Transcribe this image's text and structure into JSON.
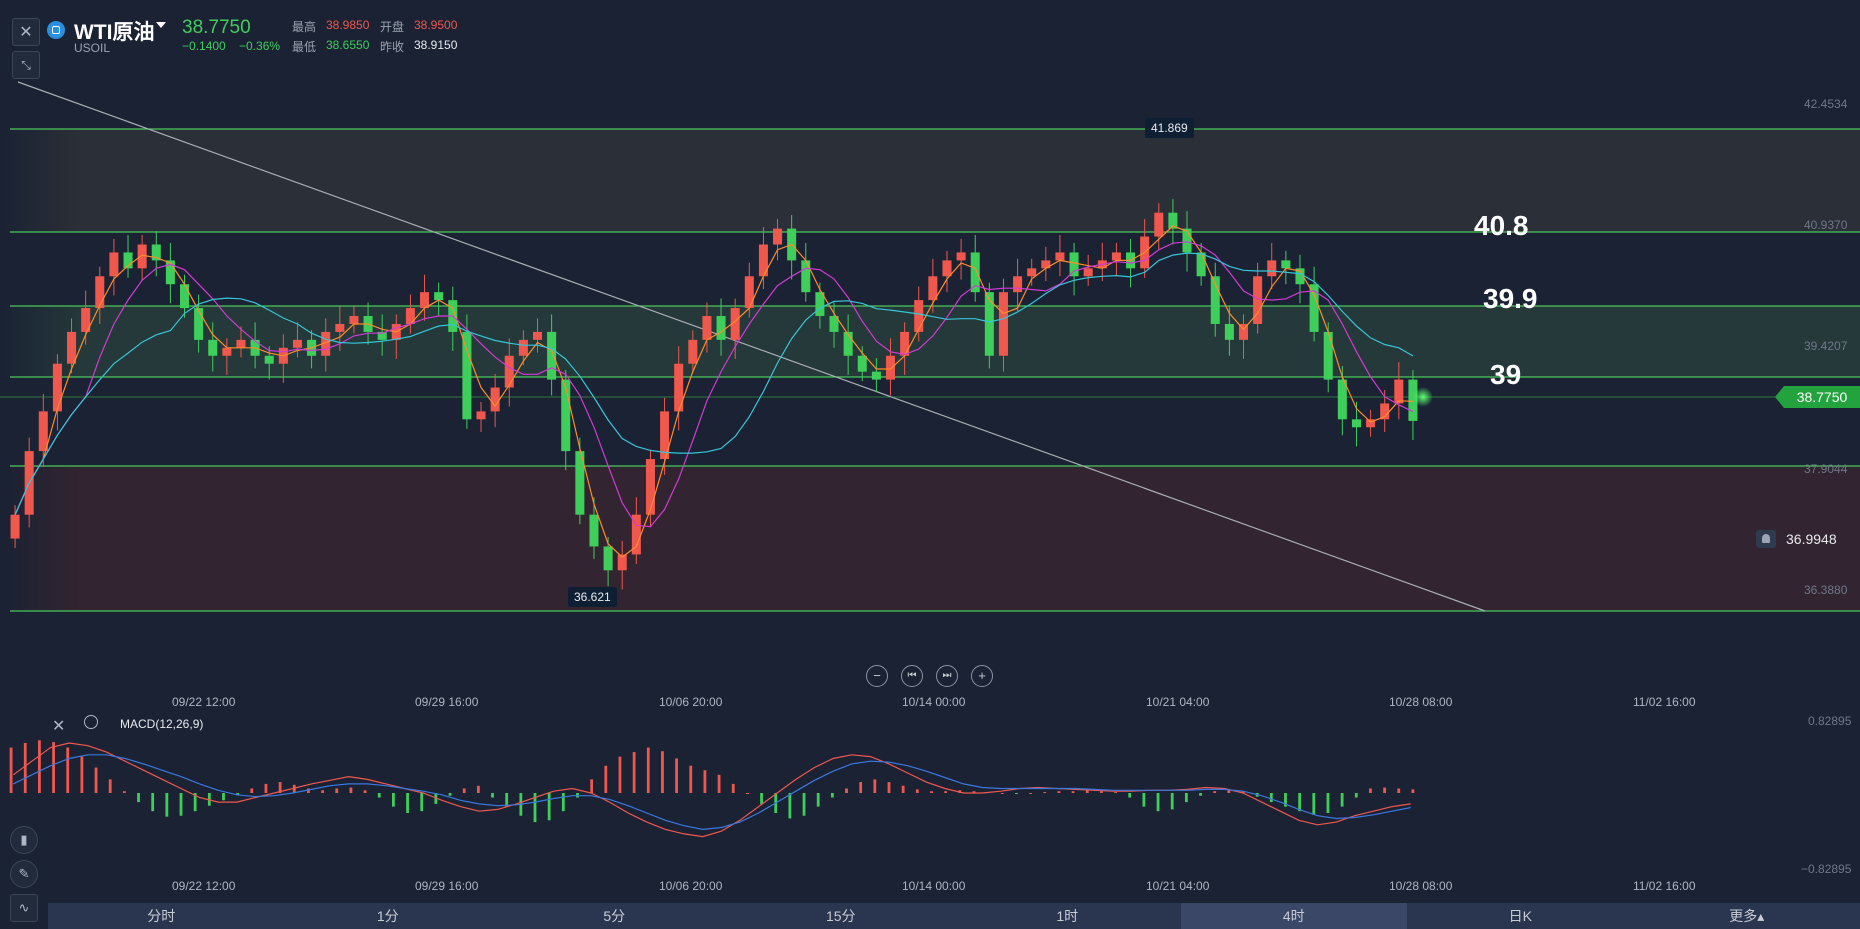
{
  "header": {
    "title": "WTI原油",
    "symbol": "USOIL",
    "price": "38.7750",
    "change": "−0.1400",
    "change_pct": "−0.36%",
    "stats": {
      "high_label": "最高",
      "high": "38.9850",
      "open_label": "开盘",
      "open": "38.9500",
      "low_label": "最低",
      "low": "38.6550",
      "prev_label": "昨收",
      "prev": "38.9150"
    }
  },
  "main_chart": {
    "y_axis_labels": [
      "42.4534",
      "40.9370",
      "39.4207",
      "37.9044",
      "36.3880"
    ],
    "x_axis_labels": [
      "09/22 12:00",
      "09/29 16:00",
      "10/06 20:00",
      "10/14 00:00",
      "10/21 04:00",
      "10/28 08:00",
      "11/02 16:00"
    ],
    "level_labels": [
      "40.8",
      "39.9",
      "39"
    ],
    "current_price_tag": "38.7750",
    "alert_price": "36.9948",
    "peak_label": "41.869",
    "trough_label": "36.621"
  },
  "indicator": {
    "label": "MACD(12,26,9)",
    "y_axis_labels": [
      "0.82895",
      "−0.82895"
    ],
    "x_axis_labels": [
      "09/22 12:00",
      "09/29 16:00",
      "10/06 20:00",
      "10/14 00:00",
      "10/21 04:00",
      "10/28 08:00",
      "11/02 16:00"
    ]
  },
  "timeframes": [
    {
      "label": "分时"
    },
    {
      "label": "1分"
    },
    {
      "label": "5分"
    },
    {
      "label": "15分"
    },
    {
      "label": "1时"
    },
    {
      "label": "4时"
    },
    {
      "label": "日K"
    },
    {
      "label": "更多▴"
    }
  ],
  "colors": {
    "up": "#f0584d",
    "down": "#3ecf5a",
    "accent": "#22a33e"
  },
  "chart_data": [
    {
      "type": "candlestick",
      "title": "",
      "ylim": [
        36.0,
        42.8
      ],
      "series": [
        {
          "name": "price",
          "close": [
            37.6,
            38.4,
            38.9,
            39.5,
            39.9,
            40.2,
            40.6,
            40.9,
            40.7,
            41.0,
            40.8,
            40.5,
            40.2,
            39.8,
            39.6,
            39.7,
            39.8,
            39.6,
            39.5,
            39.7,
            39.8,
            39.6,
            39.9,
            40.0,
            40.1,
            39.9,
            39.8,
            40.0,
            40.2,
            40.4,
            40.3,
            39.9,
            38.8,
            38.9,
            39.2,
            39.6,
            39.8,
            39.9,
            39.3,
            38.4,
            37.6,
            37.2,
            36.9,
            37.1,
            37.6,
            38.3,
            38.9,
            39.5,
            39.8,
            40.1,
            39.8,
            40.2,
            40.6,
            41.0,
            41.2,
            40.8,
            40.4,
            40.1,
            39.9,
            39.6,
            39.4,
            39.3,
            39.6,
            39.9,
            40.3,
            40.6,
            40.8,
            40.9,
            40.4,
            39.6,
            40.4,
            40.6,
            40.7,
            40.8,
            40.9,
            40.6,
            40.7,
            40.8,
            40.9,
            40.7,
            41.1,
            41.4,
            41.2,
            40.9,
            40.6,
            40.0,
            39.8,
            40.0,
            40.6,
            40.8,
            40.7,
            40.5,
            39.9,
            39.3,
            38.8,
            38.7,
            38.8,
            39.0,
            39.3,
            38.78
          ]
        },
        {
          "name": "MA5",
          "values": []
        },
        {
          "name": "MA10",
          "values": []
        },
        {
          "name": "MA20",
          "values": []
        }
      ],
      "horizontal_levels": [
        42.4534,
        40.937,
        39.9,
        39.0,
        37.9044,
        36.388
      ],
      "trendline": "descending"
    },
    {
      "type": "bar",
      "title": "MACD(12,26,9)",
      "ylim": [
        -0.82895,
        0.82895
      ],
      "series": [
        {
          "name": "histogram",
          "values": [
            0.5,
            0.55,
            0.58,
            0.56,
            0.5,
            0.4,
            0.28,
            0.15,
            0.02,
            -0.1,
            -0.2,
            -0.26,
            -0.25,
            -0.2,
            -0.14,
            -0.08,
            -0.02,
            0.05,
            0.1,
            0.12,
            0.09,
            0.05,
            0.03,
            0.05,
            0.06,
            0.03,
            -0.05,
            -0.15,
            -0.22,
            -0.2,
            -0.12,
            -0.03,
            0.05,
            0.08,
            -0.05,
            -0.15,
            -0.25,
            -0.32,
            -0.3,
            -0.2,
            -0.05,
            0.15,
            0.3,
            0.4,
            0.45,
            0.5,
            0.46,
            0.38,
            0.3,
            0.25,
            0.2,
            0.1,
            0.0,
            -0.12,
            -0.22,
            -0.28,
            -0.25,
            -0.15,
            -0.05,
            0.05,
            0.12,
            0.15,
            0.12,
            0.08,
            0.04,
            0.02,
            0.02,
            0.03,
            0.02,
            0.01,
            0.0,
            -0.01,
            0.0,
            0.01,
            0.02,
            0.02,
            0.03,
            0.02,
            0.01,
            -0.05,
            -0.15,
            -0.2,
            -0.18,
            -0.1,
            -0.03,
            0.02,
            0.04,
            0.02,
            -0.04,
            -0.1,
            -0.15,
            -0.2,
            -0.24,
            -0.22,
            -0.15,
            -0.05,
            0.05,
            0.06,
            0.05,
            0.04
          ]
        },
        {
          "name": "DIF",
          "values": [
            0.2,
            0.35,
            0.5,
            0.55,
            0.52,
            0.45,
            0.35,
            0.25,
            0.15,
            0.05,
            -0.05,
            -0.1,
            -0.1,
            -0.05,
            0.0,
            0.05,
            0.1,
            0.14,
            0.18,
            0.15,
            0.1,
            0.05,
            0.0,
            -0.08,
            -0.15,
            -0.2,
            -0.18,
            -0.12,
            -0.05,
            0.02,
            0.05,
            0.0,
            -0.1,
            -0.22,
            -0.32,
            -0.4,
            -0.45,
            -0.48,
            -0.42,
            -0.3,
            -0.15,
            0.0,
            0.15,
            0.28,
            0.38,
            0.42,
            0.4,
            0.32,
            0.22,
            0.12,
            0.05,
            0.0,
            0.0,
            0.02,
            0.05,
            0.06,
            0.05,
            0.04,
            0.03,
            0.02,
            0.02,
            0.03,
            0.03,
            0.04,
            0.06,
            0.05,
            0.0,
            -0.1,
            -0.2,
            -0.3,
            -0.35,
            -0.32,
            -0.25,
            -0.2,
            -0.15,
            -0.12
          ]
        },
        {
          "name": "DEA",
          "values": [
            0.1,
            0.2,
            0.3,
            0.38,
            0.42,
            0.42,
            0.38,
            0.32,
            0.25,
            0.18,
            0.1,
            0.03,
            -0.02,
            -0.04,
            -0.03,
            0.0,
            0.04,
            0.08,
            0.1,
            0.1,
            0.08,
            0.05,
            0.02,
            -0.02,
            -0.08,
            -0.12,
            -0.14,
            -0.13,
            -0.1,
            -0.06,
            -0.03,
            -0.03,
            -0.07,
            -0.14,
            -0.22,
            -0.3,
            -0.36,
            -0.4,
            -0.38,
            -0.32,
            -0.22,
            -0.1,
            0.02,
            0.14,
            0.24,
            0.32,
            0.35,
            0.34,
            0.3,
            0.24,
            0.17,
            0.1,
            0.06,
            0.05,
            0.05,
            0.05,
            0.05,
            0.05,
            0.04,
            0.03,
            0.03,
            0.03,
            0.03,
            0.03,
            0.04,
            0.04,
            0.02,
            -0.03,
            -0.1,
            -0.18,
            -0.25,
            -0.28,
            -0.27,
            -0.24,
            -0.2,
            -0.16
          ]
        }
      ]
    }
  ]
}
